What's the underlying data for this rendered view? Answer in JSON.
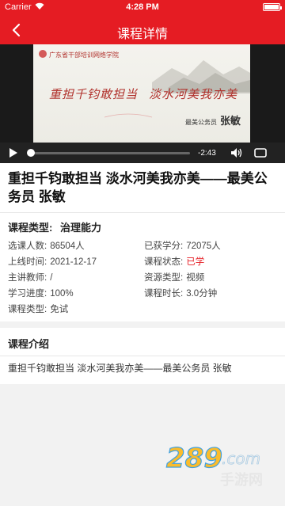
{
  "status": {
    "carrier": "Carrier",
    "time": "4:28 PM"
  },
  "navbar": {
    "title": "课程详情"
  },
  "video": {
    "org_text": "广东省干部培训网络学院",
    "headline_left": "重担千钧敢担当",
    "headline_right": "淡水河美我亦美",
    "speaker_label": "最美公务员",
    "speaker_name": "张敏",
    "remaining_time": "-2:43",
    "progress": 0.0
  },
  "course": {
    "title": "重担千钧敢担当 淡水河美我亦美——最美公务员 张敏",
    "type_label": "课程类型:",
    "type_value": "治理能力",
    "fields": [
      {
        "label": "选课人数:",
        "value": "86504人"
      },
      {
        "label": "已获学分:",
        "value": "72075人"
      },
      {
        "label": "上线时间:",
        "value": "2021-12-17"
      },
      {
        "label": "课程状态:",
        "value": "已学",
        "color": "#e51c23"
      },
      {
        "label": "主讲教师:",
        "value": "/"
      },
      {
        "label": "资源类型:",
        "value": "视频"
      },
      {
        "label": "学习进度:",
        "value": "100%"
      },
      {
        "label": "课程时长:",
        "value": "3.0分钟"
      },
      {
        "label": "课程类型:",
        "value": "免试"
      }
    ]
  },
  "intro": {
    "heading": "课程介绍",
    "text": "重担千钧敢担当 淡水河美我亦美——最美公务员 张敏"
  },
  "watermark": {
    "big": "289",
    "suffix": ".com",
    "sub": "手游网"
  },
  "colors": {
    "brand": "#e51c23"
  }
}
